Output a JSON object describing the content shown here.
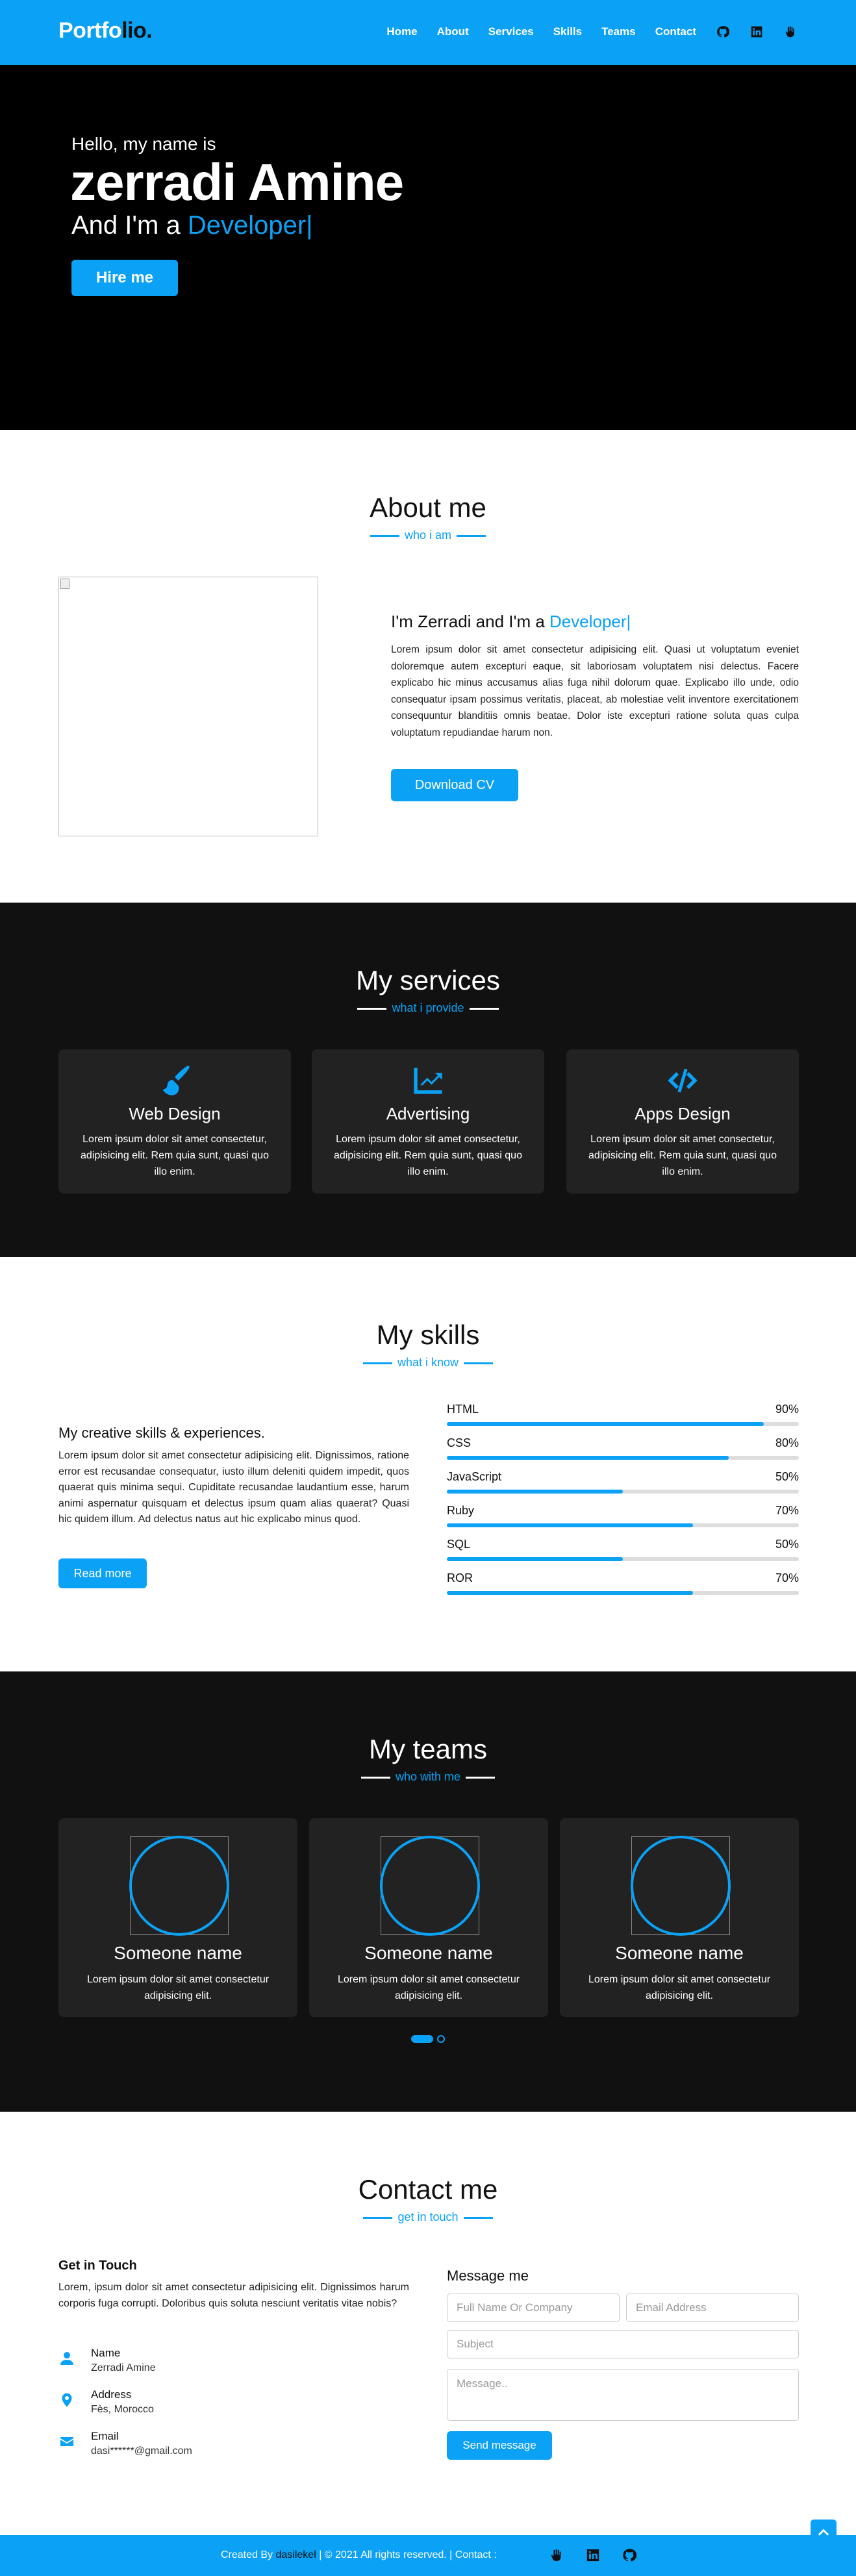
{
  "navbar": {
    "logo_main": "Portfo",
    "logo_accent": "lio.",
    "links": [
      "Home",
      "About",
      "Services",
      "Skills",
      "Teams",
      "Contact"
    ],
    "icons": [
      "github-icon",
      "linkedin-icon",
      "hand-icon"
    ]
  },
  "hero": {
    "hello": "Hello, my name is",
    "name": "zerradi Amine",
    "role_prefix": "And I'm a ",
    "role_word": "Developer",
    "cursor": "|",
    "hire_label": "Hire me"
  },
  "about": {
    "title": "About me",
    "subtitle": "who i am",
    "heading_prefix": "I'm Zerradi and I'm a ",
    "heading_word": "Developer|",
    "text": "Lorem ipsum dolor sit amet consectetur adipisicing elit. Quasi ut voluptatum eveniet doloremque autem excepturi eaque, sit laboriosam voluptatem nisi delectus. Facere explicabo hic minus accusamus alias fuga nihil dolorum quae. Explicabo illo unde, odio consequatur ipsam possimus veritatis, placeat, ab molestiae velit inventore exercitationem consequuntur blanditiis omnis beatae. Dolor iste excepturi ratione soluta quas culpa voluptatum repudiandae harum non.",
    "download_label": "Download CV"
  },
  "services": {
    "title": "My services",
    "subtitle": "what i provide",
    "cards": [
      {
        "name": "Web Design",
        "icon": "paint-brush-icon",
        "text": "Lorem ipsum dolor sit amet consectetur, adipisicing elit. Rem quia sunt, quasi quo illo enim."
      },
      {
        "name": "Advertising",
        "icon": "chart-line-icon",
        "text": "Lorem ipsum dolor sit amet consectetur, adipisicing elit. Rem quia sunt, quasi quo illo enim."
      },
      {
        "name": "Apps Design",
        "icon": "code-icon",
        "text": "Lorem ipsum dolor sit amet consectetur, adipisicing elit. Rem quia sunt, quasi quo illo enim."
      }
    ]
  },
  "skills": {
    "title": "My skills",
    "subtitle": "what i know",
    "heading": "My creative skills & experiences.",
    "text": "Lorem ipsum dolor sit amet consectetur adipisicing elit. Dignissimos, ratione error est recusandae consequatur, iusto illum deleniti quidem impedit, quos quaerat quis minima sequi. Cupiditate recusandae laudantium esse, harum animi aspernatur quisquam et delectus ipsum quam alias quaerat? Quasi hic quidem illum. Ad delectus natus aut hic explicabo minus quod.",
    "readmore_label": "Read more",
    "bars": [
      {
        "label": "HTML",
        "value": "90%",
        "level": 0.9
      },
      {
        "label": "CSS",
        "value": "80%",
        "level": 0.8
      },
      {
        "label": "JavaScript",
        "value": "50%",
        "level": 0.5
      },
      {
        "label": "Ruby",
        "value": "70%",
        "level": 0.7
      },
      {
        "label": "SQL",
        "value": "50%",
        "level": 0.5
      },
      {
        "label": "ROR",
        "value": "70%",
        "level": 0.7
      }
    ]
  },
  "teams": {
    "title": "My teams",
    "subtitle": "who with me",
    "cards": [
      {
        "name": "Someone name",
        "text": "Lorem ipsum dolor sit amet consectetur adipisicing elit."
      },
      {
        "name": "Someone name",
        "text": "Lorem ipsum dolor sit amet consectetur adipisicing elit."
      },
      {
        "name": "Someone name",
        "text": "Lorem ipsum dolor sit amet consectetur adipisicing elit."
      }
    ]
  },
  "contact": {
    "title": "Contact me",
    "subtitle": "get in touch",
    "git_title": "Get in Touch",
    "git_text": "Lorem, ipsum dolor sit amet consectetur adipisicing elit. Dignissimos harum corporis fuga corrupti. Doloribus quis soluta nesciunt veritatis vitae nobis?",
    "info": [
      {
        "label": "Name",
        "value": "Zerradi Amine",
        "icon": "user-icon"
      },
      {
        "label": "Address",
        "value": "Fès, Morocco",
        "icon": "map-marker-icon"
      },
      {
        "label": "Email",
        "value": "dasi******@gmail.com",
        "icon": "envelope-icon"
      }
    ],
    "message_title": "Message me",
    "placeholders": {
      "name": "Full Name Or Company",
      "email": "Email Address",
      "subject": "Subject",
      "message": "Message.."
    },
    "send_label": "Send message"
  },
  "footer": {
    "created_by": "Created By ",
    "author": "dasilekel",
    "rights": " | © 2021 All rights reserved. | Contact :"
  },
  "colors": {
    "accent": "#0ba1f5",
    "dark": "#111111",
    "card": "#222222"
  }
}
